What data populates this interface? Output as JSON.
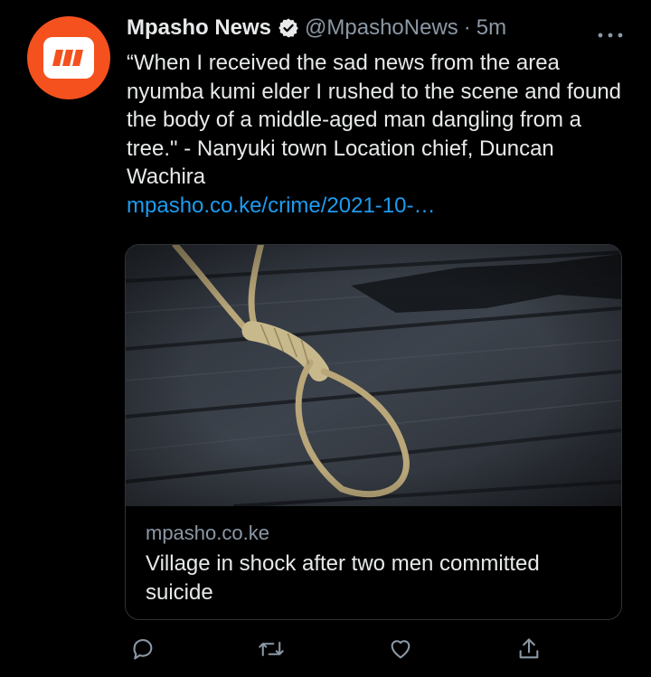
{
  "tweet": {
    "author_name": "Mpasho News",
    "handle": "@MpashoNews",
    "separator": "·",
    "time": "5m",
    "more_label": "•••",
    "text": "“When I received the sad news from the area nyumba kumi elder I rushed to the scene and found the body of a middle-aged man dangling from a tree.\" - Nanyuki town Location chief, Duncan Wachira",
    "link": "mpasho.co.ke/crime/2021-10-…"
  },
  "card": {
    "domain": "mpasho.co.ke",
    "title": "Village in shock after two men committed suicide",
    "image_icon": "noose-rope-on-wooden-planks"
  },
  "actions": [
    "reply-icon",
    "retweet-icon",
    "like-icon",
    "share-icon"
  ],
  "colors": {
    "background": "#000000",
    "avatar": "#f4511e",
    "link": "#1d9bf0",
    "verified": "#e7e9ea",
    "muted": "#8b98a5"
  }
}
